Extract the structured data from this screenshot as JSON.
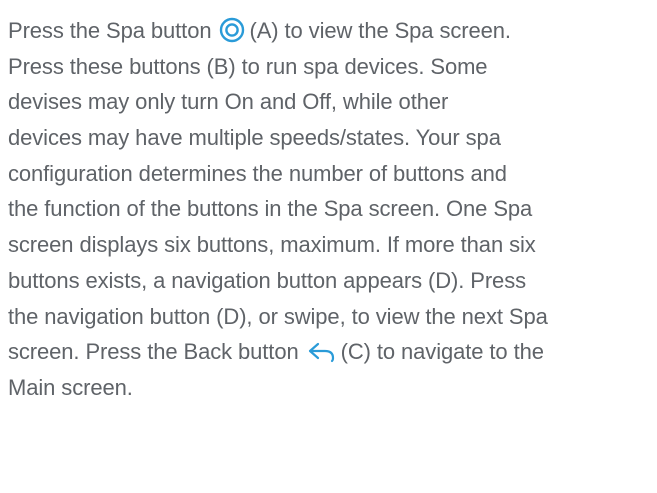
{
  "document": {
    "lines": [
      {
        "before": "Press the Spa button",
        "after": "(A) to view the Spa screen."
      },
      "Press these buttons (B) to run spa devices. Some",
      "devises may only turn On and Off, while other",
      "devices may have multiple speeds/states. Your spa",
      "configuration determines the number of buttons and",
      "the function of the buttons in the Spa screen. One Spa",
      "screen displays six buttons, maximum. If more than six",
      "buttons exists, a navigation button appears (D). Press",
      "the navigation button (D), or swipe, to view the next Spa",
      {
        "before": "screen. Press the Back button",
        "after": "(C) to navigate to the"
      },
      "Main screen."
    ],
    "icons": {
      "spa": "spa-icon",
      "back": "back-arrow-icon",
      "color": "#2a9bd8"
    }
  }
}
